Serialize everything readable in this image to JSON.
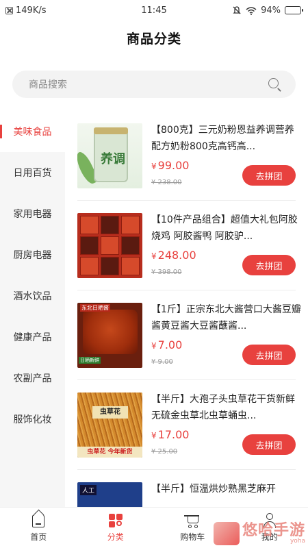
{
  "status_bar": {
    "speed": "149K/s",
    "time": "11:45",
    "battery_text": "94%",
    "battery_level": 0.94
  },
  "header": {
    "title": "商品分类"
  },
  "search": {
    "placeholder": "商品搜索"
  },
  "sidebar": {
    "items": [
      {
        "label": "美味食品",
        "active": true
      },
      {
        "label": "日用百货",
        "active": false
      },
      {
        "label": "家用电器",
        "active": false
      },
      {
        "label": "厨房电器",
        "active": false
      },
      {
        "label": "酒水饮品",
        "active": false
      },
      {
        "label": "健康产品",
        "active": false
      },
      {
        "label": "农副产品",
        "active": false
      },
      {
        "label": "服饰化妆",
        "active": false
      }
    ]
  },
  "products": [
    {
      "name": "【800克】三元奶粉恩益养调营养配方奶粉800克高钙高...",
      "currency": "¥",
      "price": "99.00",
      "original_price": "¥ 238.00",
      "button": "去拼团",
      "thumb_text": "养调"
    },
    {
      "name": "【10件产品组合】超值大礼包阿胶烧鸡 阿胶酱鸭 阿胶驴...",
      "currency": "¥",
      "price": "248.00",
      "original_price": "¥ 398.00",
      "button": "去拼团"
    },
    {
      "name": "【1斤】正宗东北大酱营口大酱豆瓣酱黄豆酱大豆酱蘸酱...",
      "currency": "¥",
      "price": "7.00",
      "original_price": "¥ 9.00",
      "button": "去拼团",
      "thumb_label_top": "东北日晒酱",
      "thumb_label_bottom": "日晒新鲜"
    },
    {
      "name": "【半斤】大孢子头虫草花干货新鲜 无硫金虫草北虫草蛹虫...",
      "currency": "¥",
      "price": "17.00",
      "original_price": "¥ 25.00",
      "button": "去拼团",
      "thumb_plate": "虫草花",
      "thumb_band": "虫草花 今年新货"
    },
    {
      "name": "【半斤】恒温烘炒熟黑芝麻开",
      "currency": "¥",
      "price": "",
      "original_price": "",
      "button": "",
      "thumb_label": "人工"
    }
  ],
  "bottom_nav": [
    {
      "label": "首页",
      "icon": "home-icon",
      "active": false
    },
    {
      "label": "分类",
      "icon": "category-icon",
      "active": true
    },
    {
      "label": "购物车",
      "icon": "cart-icon",
      "active": false
    },
    {
      "label": "我的",
      "icon": "user-icon",
      "active": false
    }
  ],
  "watermark": {
    "main": "悠哈手游",
    "sub": "yoha"
  },
  "colors": {
    "accent": "#e8413e",
    "sidebar_bg": "#f6f6f6",
    "search_bg": "#f3f3f3"
  }
}
